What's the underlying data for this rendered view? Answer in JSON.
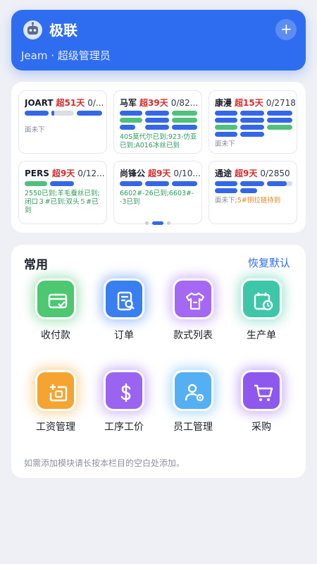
{
  "header": {
    "app_name": "极联",
    "user_line": "Jeam · 超级管理员",
    "add_symbol": "+"
  },
  "tasks": [
    {
      "name": "JOART",
      "days": "超51天",
      "ratio": "0/...",
      "note": "面未下",
      "note_color": "gray"
    },
    {
      "name": "马军",
      "days": "超39天",
      "ratio": "0/82...",
      "note": "40S莫代尔已到;923-仿亚已到;A016冰丝已到",
      "note_color": "green"
    },
    {
      "name": "康漫",
      "days": "超15天",
      "ratio": "0/2718",
      "note": "面未下",
      "note_color": "gray"
    },
    {
      "name": "PERS",
      "days": "超9天",
      "ratio": "0/12...",
      "note": "2550已到;羊毛蚕丝已到;闭口３#已到;双头５#已到",
      "note_color": "green"
    },
    {
      "name": "尚锋公",
      "days": "超9天",
      "ratio": "0/10...",
      "note": "6602#-26已到;6603#--3已到",
      "note_color": "green"
    },
    {
      "name": "通途",
      "days": "超9天",
      "ratio": "0/2850",
      "note_prefix": "面未下;",
      "note_suffix": "5#铜拉链待到",
      "note_color": "mixed"
    }
  ],
  "common": {
    "title": "常用",
    "reset_label": "恢复默认",
    "hint": "如需添加模块请长按本栏目的空白处添加。",
    "items": [
      {
        "label": "收付款",
        "icon": "wallet-check-icon",
        "color": "#4cc870"
      },
      {
        "label": "订单",
        "icon": "order-search-icon",
        "color": "#3a7ff0"
      },
      {
        "label": "款式列表",
        "icon": "tshirt-icon",
        "color": "#a468f5"
      },
      {
        "label": "生产单",
        "icon": "calendar-clock-icon",
        "color": "#3ec6a8"
      },
      {
        "label": "工资管理",
        "icon": "salary-icon",
        "color": "#f5a431"
      },
      {
        "label": "工序工价",
        "icon": "dollar-icon",
        "color": "#9a63f0"
      },
      {
        "label": "员工管理",
        "icon": "user-gear-icon",
        "color": "#54b0f2"
      },
      {
        "label": "采购",
        "icon": "cart-icon",
        "color": "#8e58ee"
      }
    ]
  }
}
